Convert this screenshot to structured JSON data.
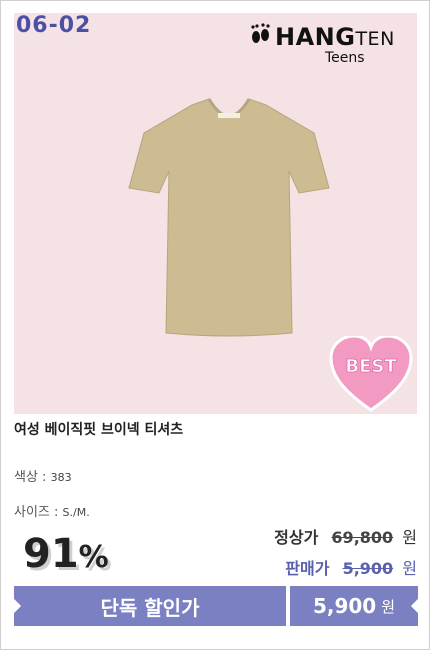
{
  "product_code": "06-02",
  "brand": {
    "name_main": "HANG",
    "name_tail": "TEN",
    "sub": "Teens"
  },
  "badge": "BEST",
  "product_title": "여성 베이직핏 브이넥 티셔츠",
  "specs": [
    {
      "label": "색상 :",
      "value": "383"
    },
    {
      "label": "사이즈 :",
      "value": "S./M."
    }
  ],
  "discount": {
    "number": "91",
    "percent_sign": "%"
  },
  "regular_price": {
    "label": "정상가",
    "amount": "69,800",
    "currency": "원"
  },
  "sale_price": {
    "label": "판매가",
    "amount": "5,900",
    "currency": "원"
  },
  "cta": {
    "label": "단독 할인가",
    "price": "5,900",
    "currency": "원"
  },
  "colors": {
    "accent": "#7b80c3",
    "code": "#4b50a6",
    "hero_bg": "#f4e2e4",
    "shirt": "#cdbb92"
  },
  "icons": [
    "footprints-icon",
    "t-shirt-image",
    "best-heart-badge"
  ]
}
